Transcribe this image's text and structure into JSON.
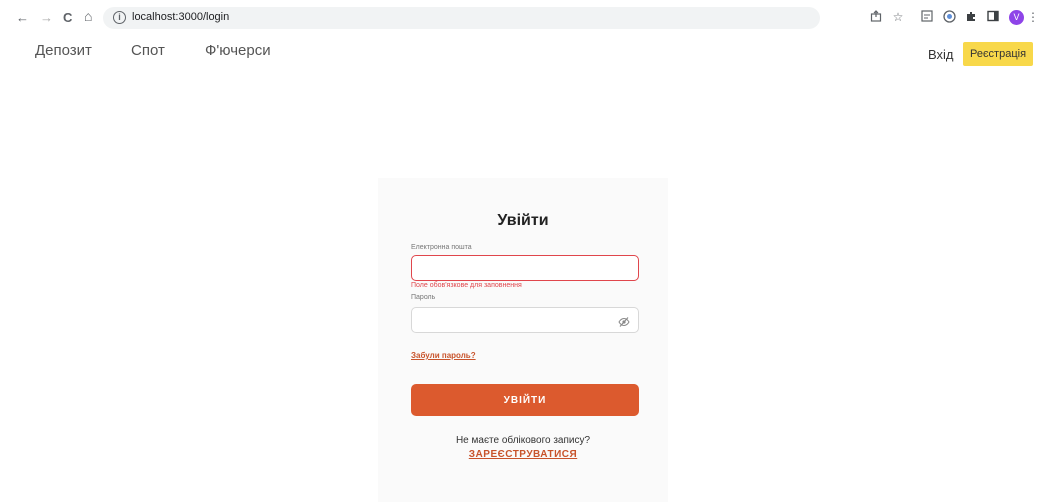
{
  "browser": {
    "url": "localhost:3000/login",
    "back_icon": "←",
    "forward_icon": "→",
    "reload_icon": "C",
    "home_icon": "⌂",
    "info_icon": "i",
    "avatar_letter": "V"
  },
  "header": {
    "nav": [
      "Депозит",
      "Спот",
      "Ф'ючерси"
    ],
    "login_label": "Вхід",
    "register_label": "Реєстрація"
  },
  "login_form": {
    "title": "Увійти",
    "email_label": "Електронна пошта",
    "email_value": "",
    "email_error": "Поле обов'язкове для заповнення",
    "password_label": "Пароль",
    "password_value": "",
    "forgot_label": "Забули пароль?",
    "submit_label": "УВІЙТИ",
    "no_account_text": "Не маєте облікового запису?",
    "signup_label": "ЗАРЕЄСТРУВАТИСЯ"
  },
  "colors": {
    "accent": "#dc5a2e",
    "register_bg": "#f8d84a",
    "error": "#e0464c"
  }
}
